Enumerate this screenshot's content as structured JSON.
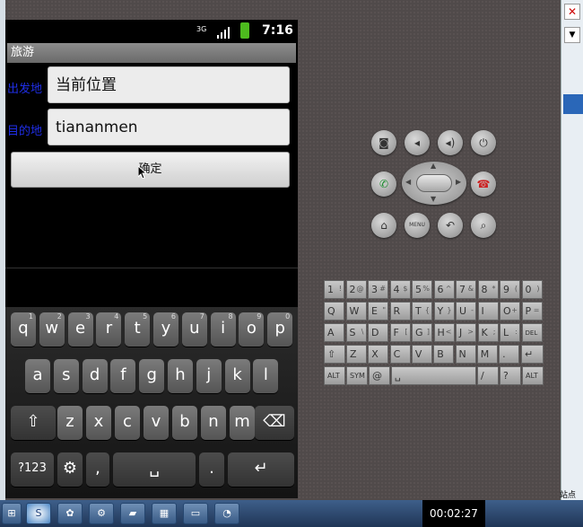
{
  "status_bar": {
    "time": "7:16",
    "network": "3G"
  },
  "app": {
    "title": "旅游",
    "from_label": "出发地",
    "from_value": "当前位置",
    "to_label": "目的地",
    "to_value": "tiananmen",
    "confirm_label": "确定"
  },
  "soft_keyboard": {
    "row1": [
      [
        "q",
        "1"
      ],
      [
        "w",
        "2"
      ],
      [
        "e",
        "3"
      ],
      [
        "r",
        "4"
      ],
      [
        "t",
        "5"
      ],
      [
        "y",
        "6"
      ],
      [
        "u",
        "7"
      ],
      [
        "i",
        "8"
      ],
      [
        "o",
        "9"
      ],
      [
        "p",
        "0"
      ]
    ],
    "row2": [
      "a",
      "s",
      "d",
      "f",
      "g",
      "h",
      "j",
      "k",
      "l"
    ],
    "row3": [
      "z",
      "x",
      "c",
      "v",
      "b",
      "n",
      "m"
    ],
    "symbols_label": "?123",
    "comma": ",",
    "period": "."
  },
  "hw_keyboard": {
    "row1": [
      [
        "1",
        "!"
      ],
      [
        "2",
        "@"
      ],
      [
        "3",
        "#"
      ],
      [
        "4",
        "$"
      ],
      [
        "5",
        "%"
      ],
      [
        "6",
        "^"
      ],
      [
        "7",
        "&"
      ],
      [
        "8",
        "*"
      ],
      [
        "9",
        "("
      ],
      [
        "0",
        ")"
      ]
    ],
    "row2": [
      [
        "Q",
        ""
      ],
      [
        "W",
        ""
      ],
      [
        "E",
        "\""
      ],
      [
        "R",
        ""
      ],
      [
        "T",
        "{"
      ],
      [
        "Y",
        "}"
      ],
      [
        "U",
        "-"
      ],
      [
        "I",
        ""
      ],
      [
        "O",
        "+"
      ],
      [
        "P",
        "="
      ]
    ],
    "row3": [
      [
        "A",
        ""
      ],
      [
        "S",
        "\\"
      ],
      [
        "D",
        ""
      ],
      [
        "F",
        "["
      ],
      [
        "G",
        "]"
      ],
      [
        "H",
        "<"
      ],
      [
        "J",
        ">"
      ],
      [
        "K",
        ";"
      ],
      [
        "L",
        ":"
      ],
      [
        "DEL",
        ""
      ]
    ],
    "row4": [
      [
        "Z",
        ""
      ],
      [
        "X",
        ""
      ],
      [
        "C",
        ""
      ],
      [
        "V",
        ""
      ],
      [
        "B",
        ""
      ],
      [
        "N",
        ""
      ],
      [
        "M",
        ""
      ],
      [
        ".",
        ""
      ]
    ],
    "alt": "ALT",
    "sym": "SYM",
    "at": "@",
    "slash": "/",
    "question": "?"
  },
  "emulator_buttons": {
    "menu_label": "MENU"
  },
  "taskbar": {
    "timer": "00:02:27",
    "right_text": "站点"
  }
}
